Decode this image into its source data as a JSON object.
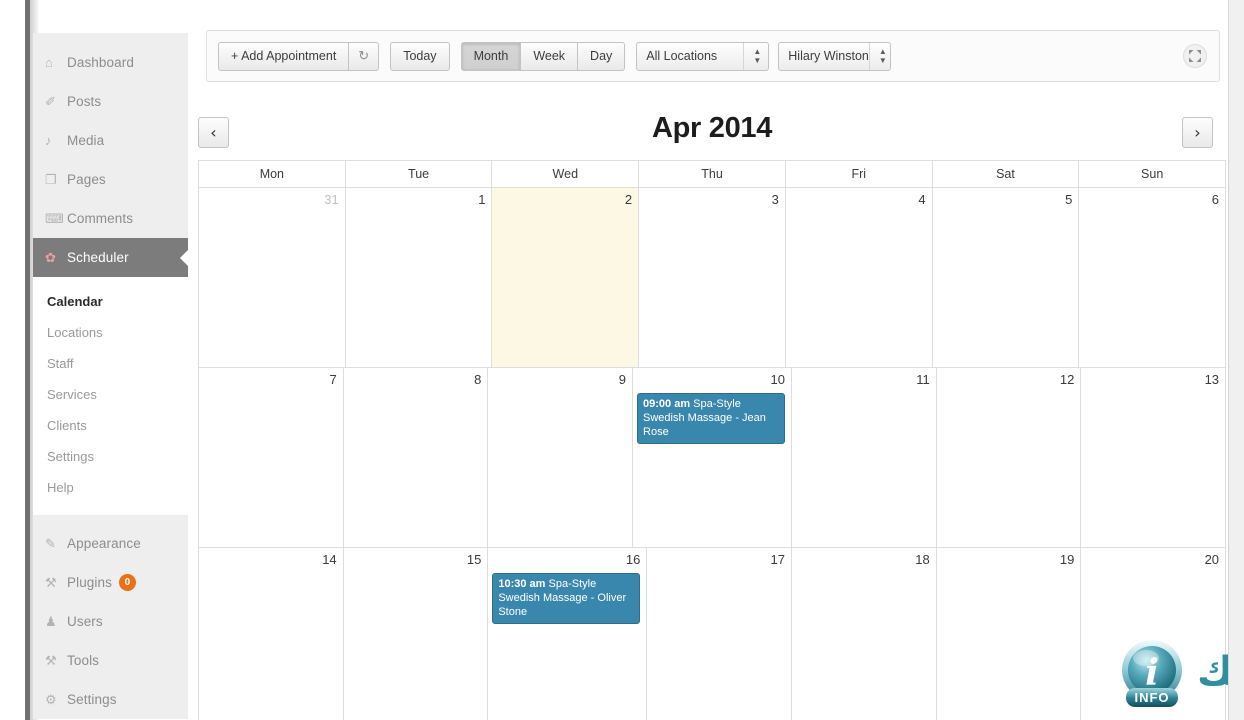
{
  "sidebar": {
    "top_items": [
      {
        "label": "Dashboard",
        "icon": "dashboard-icon",
        "glyph": "⌂"
      },
      {
        "label": "Posts",
        "icon": "pin-icon",
        "glyph": "✐"
      },
      {
        "label": "Media",
        "icon": "media-icon",
        "glyph": "♪"
      },
      {
        "label": "Pages",
        "icon": "page-icon",
        "glyph": "❐"
      },
      {
        "label": "Comments",
        "icon": "comment-icon",
        "glyph": "⌨"
      },
      {
        "label": "Scheduler",
        "icon": "scheduler-icon",
        "glyph": "✿",
        "current": true
      }
    ],
    "submenu": [
      {
        "label": "Calendar",
        "active": true
      },
      {
        "label": "Locations",
        "active": false
      },
      {
        "label": "Staff",
        "active": false
      },
      {
        "label": "Services",
        "active": false
      },
      {
        "label": "Clients",
        "active": false
      },
      {
        "label": "Settings",
        "active": false
      },
      {
        "label": "Help",
        "active": false
      }
    ],
    "bottom_items": [
      {
        "label": "Appearance",
        "icon": "brush-icon",
        "glyph": "✎"
      },
      {
        "label": "Plugins",
        "icon": "plug-icon",
        "glyph": "⚒",
        "badge": "0"
      },
      {
        "label": "Users",
        "icon": "user-icon",
        "glyph": "♟"
      },
      {
        "label": "Tools",
        "icon": "wrench-icon",
        "glyph": "⚒"
      },
      {
        "label": "Settings",
        "icon": "gear-icon",
        "glyph": "⚙"
      }
    ]
  },
  "toolbar": {
    "add_appointment_label": "+ Add Appointment",
    "refresh_icon_glyph": "↻",
    "today_label": "Today",
    "views": [
      {
        "label": "Month",
        "active": true
      },
      {
        "label": "Week",
        "active": false
      },
      {
        "label": "Day",
        "active": false
      }
    ],
    "location_select": {
      "value": "All Locations"
    },
    "staff_select": {
      "value": "Hilary Winston"
    },
    "expand_icon": "expand-arrows-icon"
  },
  "calendar": {
    "title": "Apr 2014",
    "prev_label": "‹",
    "next_label": "›",
    "day_headers": [
      "Mon",
      "Tue",
      "Wed",
      "Thu",
      "Fri",
      "Sat",
      "Sun"
    ],
    "weeks": [
      [
        {
          "day": "31",
          "other_month": true
        },
        {
          "day": "1"
        },
        {
          "day": "2",
          "today": true
        },
        {
          "day": "3"
        },
        {
          "day": "4"
        },
        {
          "day": "5"
        },
        {
          "day": "6"
        }
      ],
      [
        {
          "day": "7"
        },
        {
          "day": "8"
        },
        {
          "day": "9"
        },
        {
          "day": "10",
          "event": {
            "time": "09:00 am",
            "title": " Spa-Style Swedish Massage - Jean Rose"
          }
        },
        {
          "day": "11"
        },
        {
          "day": "12"
        },
        {
          "day": "13"
        }
      ],
      [
        {
          "day": "14"
        },
        {
          "day": "15"
        },
        {
          "day": "16",
          "event": {
            "time": "10:30 am",
            "title": " Spa-Style Swedish Massage - Oliver Stone"
          }
        },
        {
          "day": "17"
        },
        {
          "day": "18"
        },
        {
          "day": "19"
        },
        {
          "day": "20"
        }
      ]
    ]
  },
  "watermark": {
    "badge_label": "INFO",
    "badge_letter": "i",
    "text": "معلوماتيك"
  },
  "colors": {
    "event_blue": "#3a87ad",
    "today_yellow": "#fcf8e3",
    "badge_orange": "#ea7116",
    "watermark_teal": "#2f8f9d",
    "sidebar_bg": "#eeeeee",
    "current_item_bg": "#7c7c7c"
  }
}
